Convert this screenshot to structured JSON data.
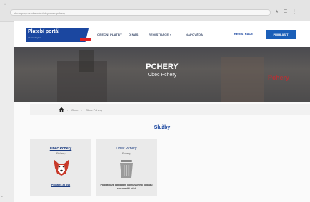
{
  "browser": {
    "tab_dots": "•",
    "url": "obcanpory.cz/obecnisplatky/obec-pchery",
    "controls": [
      "★",
      "☰",
      "⋮"
    ]
  },
  "header": {
    "logo_title": "Platebí portál",
    "logo_subtitle": "óbcanploryl.cz",
    "nav": [
      "OBECNÍ PLATBY",
      "O NÁS",
      "REGISTRACE",
      "NÁPOVĚDA"
    ],
    "register_label": "REGISTRACE",
    "login_label": "PŘIHLÁSIT"
  },
  "hero": {
    "title": "PCHERY",
    "subtitle": "Obec Pchery",
    "logo_text": "Pchery"
  },
  "breadcrumb": [
    "Obce",
    "Obec Pchery"
  ],
  "services_heading": "Služby",
  "cards": [
    {
      "title": "Obec Pchery",
      "subtitle": "Pchery",
      "action": "Poplatek za psa"
    },
    {
      "title": "Obec Pchery",
      "subtitle": "Pchery",
      "action": "Poplatek za odkládání komunálního odpadu z nemovité věci"
    }
  ],
  "colors": {
    "brand": "#1b47a0",
    "accent": "#d22222",
    "button": "#1b5fb8"
  }
}
